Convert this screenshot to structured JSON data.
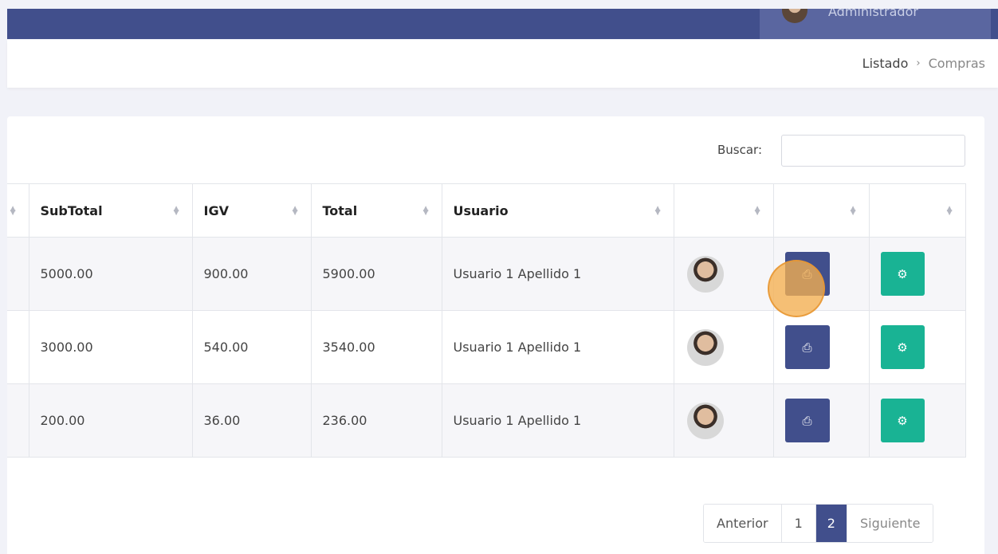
{
  "header": {
    "user_role": "Administrador"
  },
  "breadcrumb": {
    "item1": "Listado",
    "separator": "›",
    "item2": "Compras"
  },
  "search": {
    "label": "Buscar:",
    "value": "",
    "placeholder": ""
  },
  "table": {
    "columns": [
      "SubTotal",
      "IGV",
      "Total",
      "Usuario"
    ],
    "rows": [
      {
        "subtotal": "5000.00",
        "igv": "900.00",
        "total": "5900.00",
        "usuario": "Usuario 1 Apellido 1"
      },
      {
        "subtotal": "3000.00",
        "igv": "540.00",
        "total": "3540.00",
        "usuario": "Usuario 1 Apellido 1"
      },
      {
        "subtotal": "200.00",
        "igv": "36.00",
        "total": "236.00",
        "usuario": "Usuario 1 Apellido 1"
      }
    ]
  },
  "pagination": {
    "prev": "Anterior",
    "pages": [
      "1",
      "2"
    ],
    "active_page": "2",
    "next": "Siguiente"
  },
  "icons": {
    "sort": "sort-icon",
    "print": "print-icon",
    "gear": "gear-icon"
  },
  "colors": {
    "primary": "#414f8c",
    "success": "#19b394",
    "background": "#f1f2f8"
  }
}
